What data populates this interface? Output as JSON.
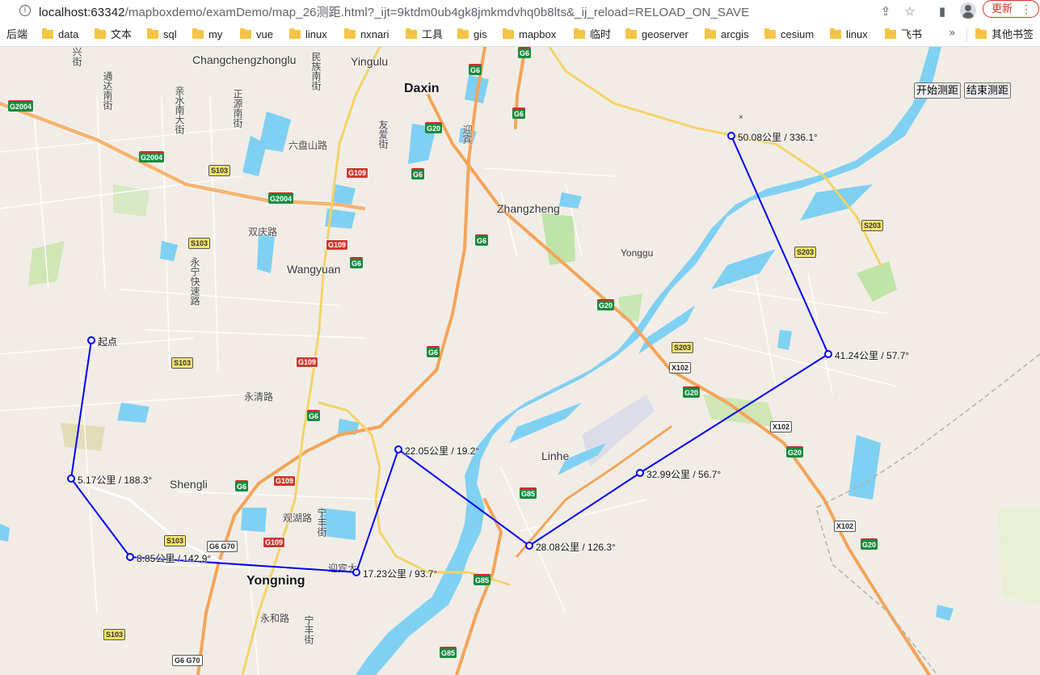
{
  "browser": {
    "url_host": "localhost:63342",
    "url_path": "/mapboxdemo/examDemo/map_26测距.html?_ijt=9ktdm0ub4gk8jmkmdvhq0b8lts&_ij_reload=RELOAD_ON_SAVE",
    "update_label": "更新",
    "bookmarks": [
      "后端",
      "data",
      "文本",
      "sql",
      "my",
      "vue",
      "linux",
      "nxnari",
      "工具",
      "gis",
      "mapbox",
      "临时",
      "geoserver",
      "arcgis",
      "cesium",
      "linux",
      "飞书"
    ],
    "more_bookmarks": "»",
    "other_bookmarks": "其他书签"
  },
  "controls": {
    "start_label": "开始测距",
    "end_label": "结束测距",
    "close_glyph": "×"
  },
  "map": {
    "places": {
      "changcheng": "Changchengzhonglu",
      "yingulu": "Yingulu",
      "daxin": "Daxin",
      "zhangzheng": "Zhangzheng",
      "yonggu": "Yonggu",
      "wangyuan": "Wangyuan",
      "shengli": "Shengli",
      "yongning": "Yongning",
      "linhe": "Linhe"
    },
    "roads": {
      "tongda": "通达南街",
      "qinshui": "亲水南大街",
      "zhengyuan": "正源南街",
      "minzu": "民族南街",
      "youai": "友爱街",
      "liupanshan": "六盘山路",
      "yingbin": "迎宾",
      "shuangqing": "双庆路",
      "yongning_kuai": "永宁快速路",
      "yongqing": "永清路",
      "guanhu": "观湖路",
      "ningfeng": "宁丰街",
      "yingbin2": "迎宾大",
      "yonghe": "永和路",
      "ningfeng2": "宁丰街",
      "xian_top": "兴街"
    },
    "shields": [
      "G2004",
      "G2004",
      "G2004",
      "S103",
      "S103",
      "S103",
      "S103",
      "S103",
      "G109",
      "G109",
      "G109",
      "G109",
      "G109",
      "G6",
      "G6",
      "G6",
      "G6",
      "G6",
      "G6",
      "G6",
      "G6",
      "G20",
      "G20",
      "G20",
      "G20",
      "G20",
      "S203",
      "S203",
      "S203",
      "X102",
      "X102",
      "X102",
      "G85",
      "G85",
      "G85",
      "G6 G70",
      "G6 G70"
    ]
  },
  "measure": {
    "start": "起点",
    "labels": [
      "5.17公里 / 188.3°",
      "8.85公里 / 142.9°",
      "17.23公里 / 93.7°",
      "22.05公里 / 19.2°",
      "28.08公里 / 126.3°",
      "32.99公里 / 56.7°",
      "41.24公里 / 57.7°",
      "50.08公里 / 336.1°"
    ],
    "line_color": "#0000ff"
  }
}
